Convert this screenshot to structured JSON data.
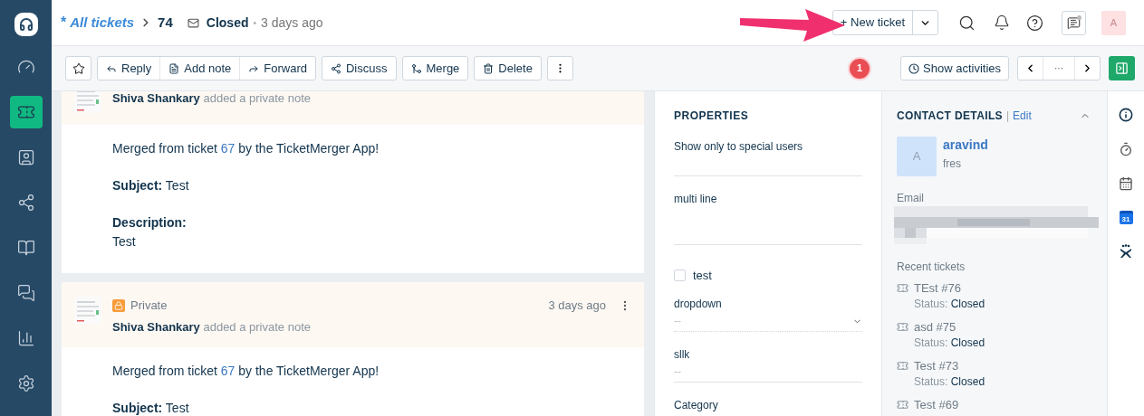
{
  "sidebar": {
    "items": [
      {
        "kind": "logo",
        "selected": false
      },
      {
        "kind": "dashboard",
        "selected": false
      },
      {
        "kind": "tickets",
        "selected": true
      },
      {
        "kind": "contacts",
        "selected": false
      },
      {
        "kind": "network",
        "selected": false
      },
      {
        "kind": "book",
        "selected": false
      },
      {
        "kind": "chat",
        "selected": false
      },
      {
        "kind": "reports",
        "selected": false
      },
      {
        "kind": "settings",
        "selected": false
      }
    ]
  },
  "header": {
    "marker": "*",
    "breadcrumb": "All tickets",
    "ticket_id": "74",
    "status": "Closed",
    "separator": "•",
    "time": "3 days ago",
    "new_ticket": "+ New ticket",
    "avatar": "A"
  },
  "toolbar": {
    "groups": [
      [
        "Reply",
        "Add note",
        "Forward"
      ],
      [
        "Discuss"
      ],
      [
        "Merge"
      ],
      [
        "Delete"
      ]
    ],
    "badge": "1",
    "show_activities": "Show activities",
    "pager": "···"
  },
  "conversation": [
    {
      "author": "Shiva Shankary",
      "action": "added a private note",
      "message": {
        "before": "Merged from ticket ",
        "link": "67",
        "after": " by the TicketMerger App!"
      },
      "fields": [
        {
          "kind": "inline",
          "text": "**Subject:** Test"
        },
        {
          "kind": "block",
          "label": "Description:",
          "value": "Test"
        }
      ]
    },
    {
      "private": "Private",
      "time": "3 days ago",
      "author": "Shiva Shankary",
      "action": "added a private note",
      "message": {
        "before": "Merged from ticket ",
        "link": "67",
        "after": " by the TicketMerger App!"
      },
      "fields": [
        {
          "kind": "inline",
          "text": "**Subject:** Test"
        }
      ]
    }
  ],
  "properties": {
    "title": "PROPERTIES",
    "fields": [
      {
        "kind": "text",
        "label": "Show only to special users"
      },
      {
        "kind": "textarea",
        "label": "multi line"
      },
      {
        "kind": "checkbox",
        "label": "test",
        "checked": false
      },
      {
        "kind": "dropdown",
        "label": "dropdown",
        "placeholder": "--"
      },
      {
        "kind": "text",
        "label": "sllk",
        "placeholder": "--"
      },
      {
        "kind": "text",
        "label": "Category"
      }
    ]
  },
  "contact": {
    "title": "CONTACT DETAILS",
    "divider": "|",
    "edit": "Edit",
    "avatar": "A",
    "name": "aravind",
    "company": "fres",
    "email_label": "Email",
    "recent_label": "Recent tickets",
    "tickets": [
      {
        "title": "TEst #76",
        "status_label": "Status:",
        "status": "Closed"
      },
      {
        "title": "asd #75",
        "status_label": "Status:",
        "status": "Closed"
      },
      {
        "title": "Test #73",
        "status_label": "Status:",
        "status": "Closed"
      },
      {
        "title": "Test #69"
      }
    ]
  },
  "rail": {
    "calendar_day": "31"
  }
}
